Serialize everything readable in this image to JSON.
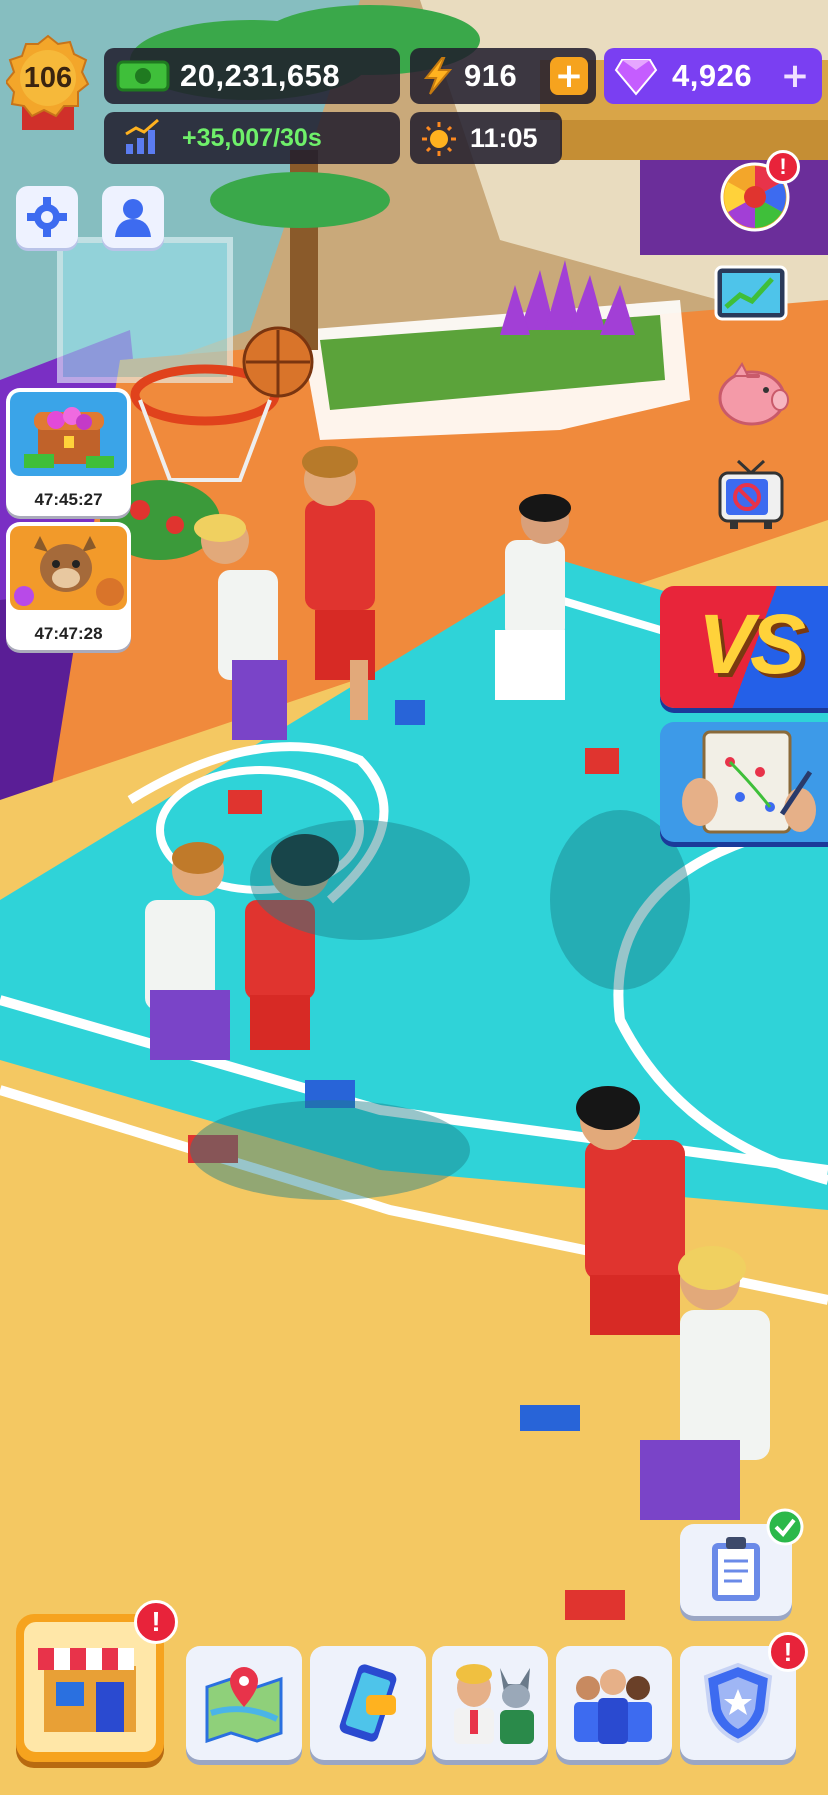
{
  "hud": {
    "level": "106",
    "cash": "20,231,658",
    "energy": "916",
    "gems": "4,926",
    "income_rate": "+35,007/30s",
    "clock": "11:05",
    "energy_plus": "+",
    "gems_plus": "+"
  },
  "left_events": [
    {
      "name": "treasure-chest-event",
      "timer": "47:45:27"
    },
    {
      "name": "mascot-gem-event",
      "timer": "47:47:28"
    }
  ],
  "right_panel": {
    "vs_label": "VS"
  },
  "alerts": {
    "mark": "!"
  },
  "colors": {
    "court": "#2fd3d8",
    "floor": "#f4c862",
    "red_team": "#e0342f",
    "white_team": "#f2f4f2",
    "accent_purple": "#7b3ff2",
    "alert_red": "#e8233a"
  },
  "icons": {
    "settings": "gear-icon",
    "profile": "player-icon",
    "wheel": "lucky-wheel-icon",
    "stats": "stats-board-icon",
    "piggy": "piggy-bank-icon",
    "tv": "no-ads-tv-icon",
    "tactics": "tactics-board-icon",
    "tasks": "clipboard-icon",
    "shop": "shop-icon",
    "map": "map-icon",
    "phone": "phone-icon",
    "staff": "staff-icon",
    "team": "team-icon",
    "badge": "shield-badge-icon"
  }
}
